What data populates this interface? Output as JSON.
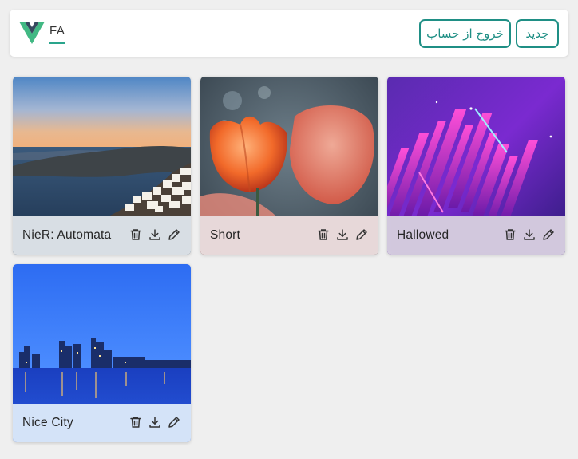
{
  "header": {
    "lang_label": "FA",
    "logout_label": "خروج از حساب",
    "new_label": "جدید"
  },
  "colors": {
    "accent": "#1f8f85",
    "underline": "#2aa58c",
    "logo_outer": "#41b883",
    "logo_inner": "#35495e"
  },
  "cards": [
    {
      "title": "NieR: Automata",
      "image": "santorini-sunset"
    },
    {
      "title": "Short",
      "image": "orange-tulips"
    },
    {
      "title": "Hallowed",
      "image": "neon-abstract"
    },
    {
      "title": "Nice City",
      "image": "city-skyline-night"
    }
  ],
  "icons": [
    "trash-icon",
    "download-icon",
    "pencil-icon"
  ]
}
